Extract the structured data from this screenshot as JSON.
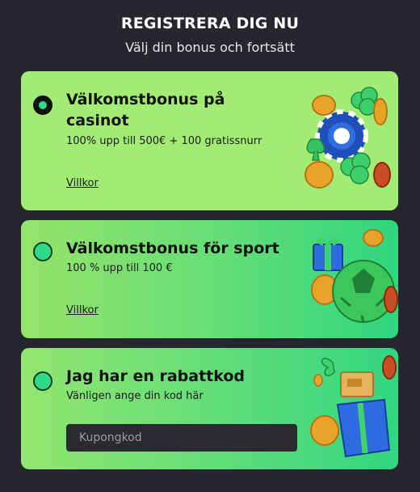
{
  "header": {
    "title": "REGISTRERA DIG NU",
    "subtitle": "Välj din bonus och fortsätt"
  },
  "options": [
    {
      "title_line1": "Välkomstbonus på",
      "title_line2": "casinot",
      "description": "100% upp till 500€ + 100 gratissnurr",
      "link_label": "Villkor",
      "selected": true,
      "art_icon": "casino-chips-clover-icon"
    },
    {
      "title_line1": "Välkomstbonus för sport",
      "description": "100 % upp till 100 €",
      "link_label": "Villkor",
      "selected": false,
      "art_icon": "soccer-ball-gift-icon"
    },
    {
      "title_line1": "Jag har en rabattkod",
      "description": "Vänligen ange din kod här",
      "coupon_placeholder": "Kupongkod",
      "coupon_value": "",
      "selected": false,
      "art_icon": "open-gift-box-icon"
    }
  ],
  "colors": {
    "page_background": "#26272e",
    "card1": "#a2ec73",
    "card_gradient_end": "#2fd57f",
    "radio_fill": "#2fd98a",
    "coin_gold": "#e8a328"
  }
}
